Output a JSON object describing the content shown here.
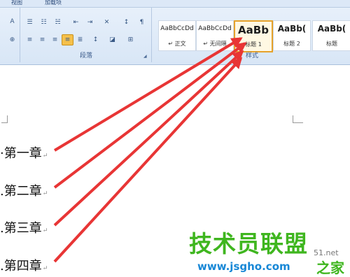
{
  "tabs": [
    "视图",
    "加载项"
  ],
  "paragraph_group": {
    "label": "段落",
    "row1": [
      "bullets-icon",
      "numbering-icon",
      "multilevel-list-icon",
      "decrease-indent-icon",
      "increase-indent-icon",
      "chinese-layout-icon",
      "sort-icon",
      "show-marks-icon"
    ],
    "row2": [
      "align-left-icon",
      "center-icon",
      "align-right-icon",
      "justify-icon",
      "distributed-icon",
      "line-spacing-icon",
      "shading-icon",
      "borders-icon"
    ],
    "active": "justify-icon"
  },
  "styles_group": {
    "label": "样式",
    "items": [
      {
        "sample": "AaBbCcDd",
        "name": "↵ 正文"
      },
      {
        "sample": "AaBbCcDd",
        "name": "↵ 无间隔"
      },
      {
        "sample": "AaBb",
        "name": "标题 1"
      },
      {
        "sample": "AaBb(",
        "name": "标题 2"
      },
      {
        "sample": "AaBb(",
        "name": "标题"
      }
    ],
    "selected": 2
  },
  "document": {
    "headings": [
      "第一章",
      "第二章",
      "第三章",
      "第四章"
    ],
    "para_mark": "↵"
  },
  "watermark": {
    "main": "技术员联盟",
    "url": "www.jsgho.com",
    "partial": "51.net",
    "site": "之家"
  },
  "colors": {
    "arrow": "#e83535",
    "accent": "#e6a22a",
    "watermark_green": "#3fb61f",
    "watermark_blue": "#1787d6"
  }
}
